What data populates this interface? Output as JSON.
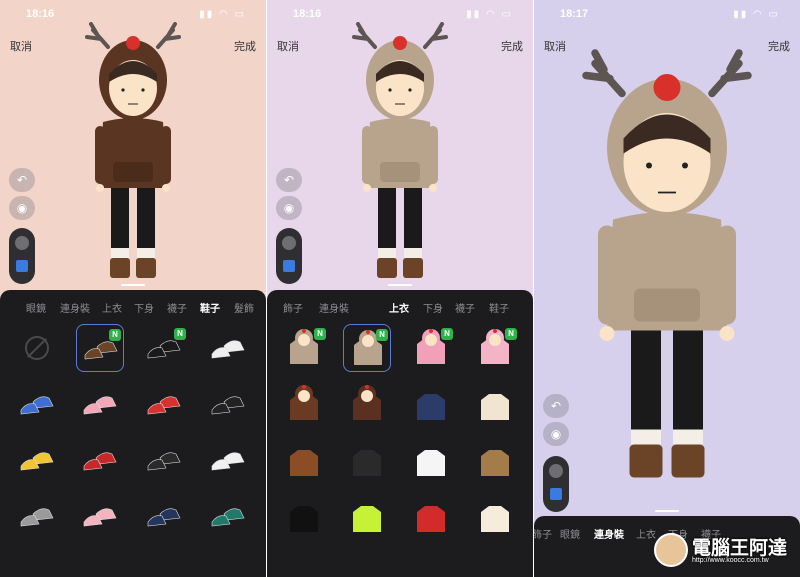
{
  "watermark": {
    "text": "電腦王阿達",
    "url": "http://www.koocc.com.tw"
  },
  "colors": {
    "sheet": "#1c1c1e",
    "accent": "#5d7bd6",
    "new_badge": "#2eb34b"
  },
  "panels": [
    {
      "time": "18:16",
      "cancel_label": "取消",
      "done_label": "完成",
      "undo_icon": "undo-icon",
      "camera_icon": "camera-icon",
      "tabs": [
        "眼鏡",
        "連身裝",
        "上衣",
        "下身",
        "襪子",
        "鞋子",
        "髮飾"
      ],
      "active_tab": "鞋子",
      "new_badge": "N",
      "items": [
        "none",
        "brown-boots",
        "black-boots",
        "white-sneakers",
        "blue-sneakers",
        "pink-sneakers",
        "red-sneakers",
        "black-sneakers",
        "yellow-sneakers",
        "red-low-sneakers",
        "black-low-sneakers",
        "white-low-sneakers",
        "grey-sneakers",
        "pink-low-sneakers",
        "navy-sneakers",
        "green-sneakers"
      ]
    },
    {
      "time": "18:16",
      "cancel_label": "取消",
      "done_label": "完成",
      "tabs": [
        "飾子",
        "連身裝",
        "上衣",
        "下身",
        "襪子",
        "鞋子"
      ],
      "active_tab": "上衣",
      "new_badge": "N",
      "items": [
        "reindeer-hoodie-tan",
        "reindeer-hoodie-tan-selected",
        "reindeer-hoodie-pink",
        "reindeer-hoodie-pink-2",
        "reindeer-hoodie-brown",
        "reindeer-hoodie-brown-2",
        "navy-sweater",
        "cream-sweater",
        "brown-sweater",
        "black-sweater",
        "white-jacket",
        "brown-jacket",
        "black-track-jacket",
        "neon-jacket",
        "red-jacket",
        "cream-sweater-2"
      ]
    },
    {
      "time": "18:17",
      "cancel_label": "取消",
      "done_label": "完成",
      "tabs": [
        "飾子",
        "眼鏡",
        "連身裝",
        "上衣",
        "下身",
        "襪子"
      ],
      "active_tab": "連身裝"
    }
  ]
}
